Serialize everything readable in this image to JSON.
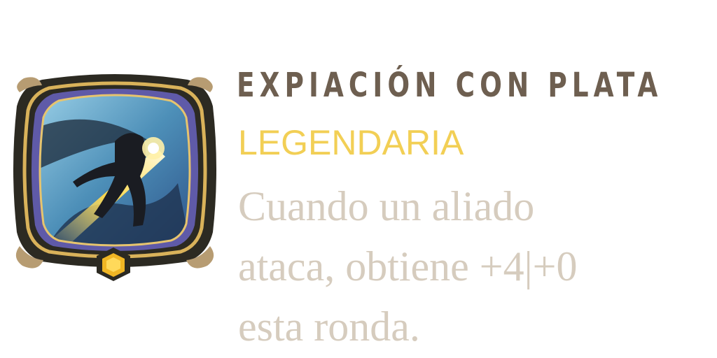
{
  "card": {
    "title": "EXPIACIÓN CON PLATA",
    "rarity": "LEGENDARIA",
    "description_lines": [
      "Cuando un aliado",
      "ataca, obtiene +4|+0",
      "esta ronda."
    ]
  },
  "colors": {
    "title": "#6e5f50",
    "rarity": "#f2cf55",
    "description": "#d6ccbe",
    "frame_outer": "#2c2a22",
    "frame_gold": "#d9b25a",
    "frame_purple": "#5f5aa8",
    "gem": "#f0b624"
  },
  "icons": {
    "emblem": "creature-attack-artwork-icon",
    "gem": "hexagon-gem-icon"
  }
}
